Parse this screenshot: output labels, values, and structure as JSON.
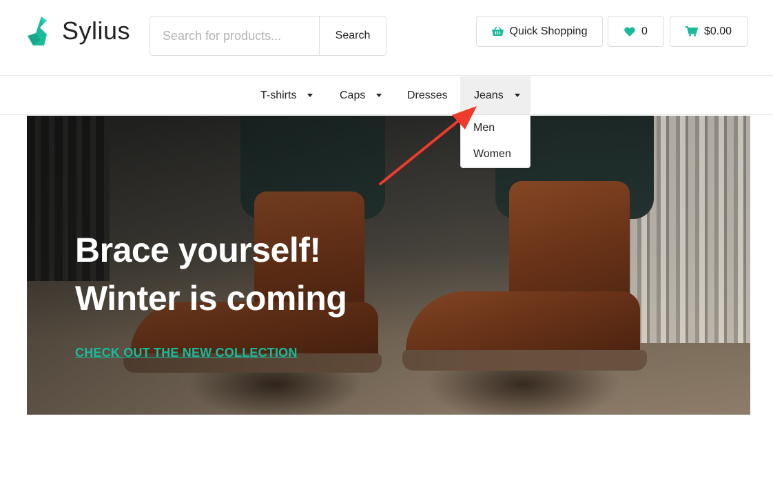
{
  "header": {
    "logo_text": "Sylius",
    "search": {
      "placeholder": "Search for products...",
      "value": "",
      "button_label": "Search"
    },
    "quick_shopping_label": "Quick Shopping",
    "wishlist_count": "0",
    "cart_total": "$0.00"
  },
  "nav": {
    "items": [
      {
        "label": "T-shirts",
        "has_dropdown": true
      },
      {
        "label": "Caps",
        "has_dropdown": true
      },
      {
        "label": "Dresses",
        "has_dropdown": false
      },
      {
        "label": "Jeans",
        "has_dropdown": true,
        "active": true
      }
    ],
    "open_dropdown": {
      "parent": "Jeans",
      "items": [
        "Men",
        "Women"
      ]
    }
  },
  "hero": {
    "title_line1": "Brace yourself!",
    "title_line2": "Winter is coming",
    "link_label": "CHECK OUT THE NEW COLLECTION"
  },
  "colors": {
    "brand": "#1abb9c",
    "annotation": "#ee3b2c",
    "text": "#222222"
  },
  "icons": [
    "logo-icon",
    "basket-icon",
    "heart-icon",
    "cart-icon",
    "caret-down-icon",
    "annotation-arrow"
  ]
}
